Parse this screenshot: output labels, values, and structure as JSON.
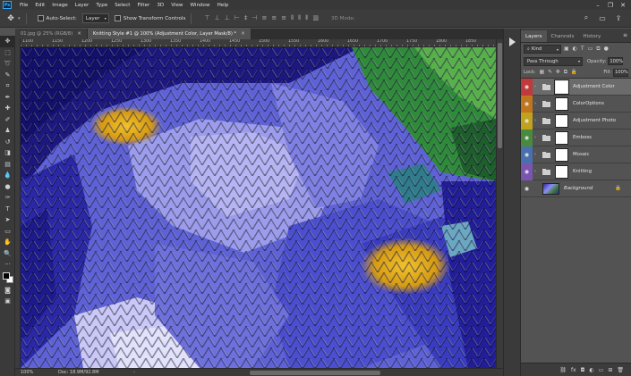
{
  "app": {
    "logo": "Ps",
    "menus": [
      "File",
      "Edit",
      "Image",
      "Layer",
      "Type",
      "Select",
      "Filter",
      "3D",
      "View",
      "Window",
      "Help"
    ],
    "window_controls": [
      "minimize-icon",
      "restore-icon",
      "close-icon"
    ]
  },
  "options": {
    "auto_select_label": "Auto-Select:",
    "auto_select_target": "Layer",
    "show_transform_label": "Show Transform Controls",
    "mode_3d_label": "3D Mode:"
  },
  "tabs": [
    {
      "label": "01.jpg @ 25% (RGB/8)",
      "active": false
    },
    {
      "label": "Knitting Style #1 @ 100% (Adjustment Color, Layer Mask/8) *",
      "active": true
    }
  ],
  "ruler": {
    "labels": [
      "1100",
      "1150",
      "1200",
      "1250",
      "1300",
      "1350",
      "1400",
      "1450",
      "1500",
      "1550",
      "1600",
      "1650",
      "1700",
      "1750",
      "1800",
      "1850"
    ]
  },
  "status": {
    "zoom": "100%",
    "doc": "Doc: 18.9M/92.8M"
  },
  "layers_panel": {
    "tabs": [
      "Layers",
      "Channels",
      "History"
    ],
    "active_tab": "Layers",
    "filter_kind": "Kind",
    "blend_mode": "Pass Through",
    "opacity_label": "Opacity:",
    "opacity_value": "100%",
    "lock_label": "Lock:",
    "fill_label": "Fill:",
    "fill_value": "100%",
    "layers": [
      {
        "name": "Adjustment Color",
        "color": "#c0393b",
        "type": "group",
        "selected": true
      },
      {
        "name": "ColorOptions",
        "color": "#c1751c",
        "type": "group",
        "selected": false
      },
      {
        "name": "Adjustment Photo",
        "color": "#c1a21f",
        "type": "group",
        "selected": false
      },
      {
        "name": "Emboss",
        "color": "#4a8a3f",
        "type": "group",
        "selected": false
      },
      {
        "name": "Mosaic",
        "color": "#4a6fae",
        "type": "group",
        "selected": false
      },
      {
        "name": "Knitting",
        "color": "#7a54b0",
        "type": "group",
        "selected": false
      },
      {
        "name": "Background",
        "color": "",
        "type": "background",
        "selected": false
      }
    ]
  }
}
